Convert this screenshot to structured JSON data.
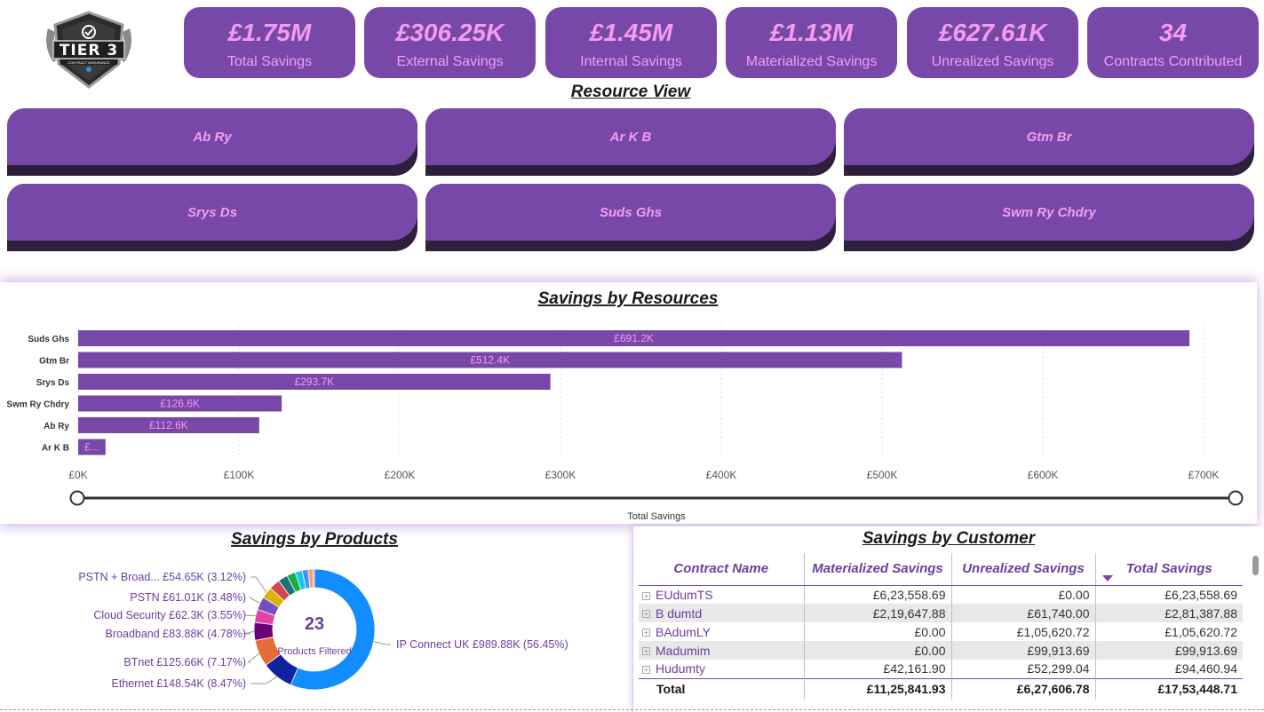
{
  "logo": {
    "text": "TIER 3",
    "subtext": "CONTRACT ASSURANCE"
  },
  "kpis": [
    {
      "value": "£1.75M",
      "label": "Total Savings"
    },
    {
      "value": "£306.25K",
      "label": "External Savings"
    },
    {
      "value": "£1.45M",
      "label": "Internal Savings"
    },
    {
      "value": "£1.13M",
      "label": "Materialized Savings"
    },
    {
      "value": "£627.61K",
      "label": "Unrealized Savings"
    },
    {
      "value": "34",
      "label": "Contracts Contributed"
    }
  ],
  "resource_view": {
    "title": "Resource View",
    "buttons": [
      "Ab Ry",
      "Ar K B",
      "Gtm Br",
      "Srys Ds",
      "Suds Ghs",
      "Swm Ry Chdry"
    ]
  },
  "colors": {
    "accent": "#7848a8",
    "pink": "#f49cf0",
    "dark": "#2e1f3c"
  },
  "chart_data": [
    {
      "type": "bar",
      "orientation": "horizontal",
      "title": "Savings by Resources",
      "xlabel": "Total Savings",
      "ylabel": "",
      "categories": [
        "Suds Ghs",
        "Gtm Br",
        "Srys Ds",
        "Swm Ry Chdry",
        "Ab Ry",
        "Ar K B"
      ],
      "values": [
        691200,
        512400,
        293700,
        126600,
        112600,
        17000
      ],
      "data_labels": [
        "£691.2K",
        "£512.4K",
        "£293.7K",
        "£126.6K",
        "£112.6K",
        "£..."
      ],
      "xticks": [
        "£0K",
        "£100K",
        "£200K",
        "£300K",
        "£400K",
        "£500K",
        "£600K",
        "£700K"
      ],
      "xlim": [
        0,
        700000
      ],
      "grid": true,
      "color": "#7848a8"
    },
    {
      "type": "pie",
      "style": "donut",
      "title": "Savings by Products",
      "center_value": "23",
      "center_label": "Products Filtered",
      "slices": [
        {
          "label": "IP Connect UK £989.88K (56.45%)",
          "value": 56.45,
          "color": "#118dff"
        },
        {
          "label": "Ethernet £148.54K (8.47%)",
          "value": 8.47,
          "color": "#12239e"
        },
        {
          "label": "BTnet £125.66K (7.17%)",
          "value": 7.17,
          "color": "#e66c37"
        },
        {
          "label": "Broadband £83.88K (4.78%)",
          "value": 4.78,
          "color": "#6b007b"
        },
        {
          "label": "Cloud Security £62.3K (3.55%)",
          "value": 3.55,
          "color": "#e044a7"
        },
        {
          "label": "PSTN £61.01K (3.48%)",
          "value": 3.48,
          "color": "#744ec2"
        },
        {
          "label": "PSTN + Broad... £54.65K (3.12%)",
          "value": 3.12,
          "color": "#d9b300"
        },
        {
          "label": "",
          "value": 2.9,
          "color": "#d64550"
        },
        {
          "label": "",
          "value": 2.6,
          "color": "#197278"
        },
        {
          "label": "",
          "value": 2.3,
          "color": "#1aab40"
        },
        {
          "label": "",
          "value": 1.9,
          "color": "#15c6f4"
        },
        {
          "label": "",
          "value": 1.6,
          "color": "#4092ff"
        },
        {
          "label": "",
          "value": 1.3,
          "color": "#ffa058"
        },
        {
          "label": "",
          "value": 0.39,
          "color": "#be5dc9"
        }
      ]
    }
  ],
  "customer_table": {
    "title": "Savings by Customer",
    "headers": [
      "Contract Name",
      "Materialized Savings",
      "Unrealized Savings",
      "Total Savings"
    ],
    "rows": [
      [
        "EUdumTS",
        "£6,23,558.69",
        "£0.00",
        "£6,23,558.69"
      ],
      [
        "B dumtd",
        "£2,19,647.88",
        "£61,740.00",
        "£2,81,387.88"
      ],
      [
        "BAdumLY",
        "£0.00",
        "£1,05,620.72",
        "£1,05,620.72"
      ],
      [
        "Madumim",
        "£0.00",
        "£99,913.69",
        "£99,913.69"
      ],
      [
        "Hudumty",
        "£42,161.90",
        "£52,299.04",
        "£94,460.94"
      ]
    ],
    "total": [
      "Total",
      "£11,25,841.93",
      "£6,27,606.78",
      "£17,53,448.71"
    ]
  }
}
